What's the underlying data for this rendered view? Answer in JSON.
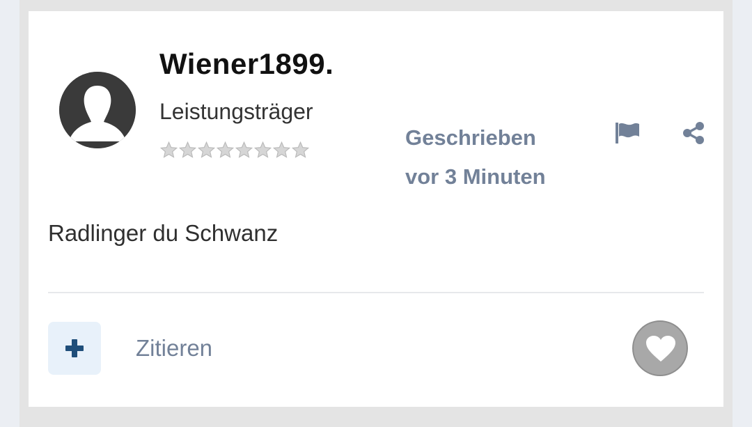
{
  "post": {
    "author": {
      "username": "Wiener1899.",
      "rank": "Leistungsträger",
      "stars_total": 8,
      "stars_filled": 0
    },
    "meta": {
      "line1": "Geschrieben",
      "line2": "vor 3 Minuten"
    },
    "icons": {
      "report": "flag-icon",
      "share": "share-icon",
      "avatar": "default-avatar",
      "quote_toggle": "plus-icon",
      "like": "heart-icon"
    },
    "content": "Radlinger du Schwanz",
    "actions": {
      "quote_label": "Zitieren"
    }
  },
  "colors": {
    "meta_text": "#728198",
    "accent": "#1f4e7a",
    "like_bg": "#a8a8a8"
  }
}
